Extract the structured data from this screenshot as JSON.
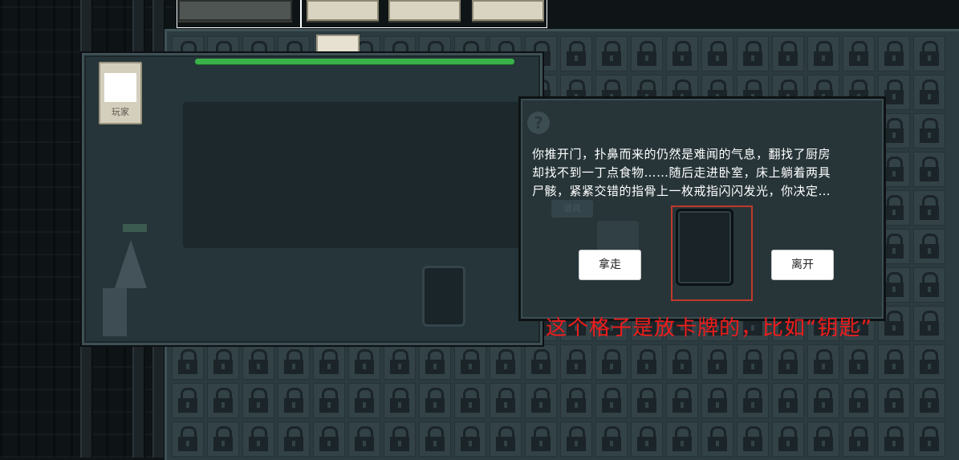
{
  "player_card": {
    "name": "玩家"
  },
  "health_bar": {
    "fraction": 1.0,
    "color": "#3bb24a"
  },
  "event_dialog": {
    "icon": "question-icon",
    "story_lines": [
      "你推开门，扑鼻而来的仍然是难闻的气息，翻找了厨房",
      "却找不到一丁点食物……随后走进卧室，床上躺着两具",
      "尸骸，紧紧交错的指骨上一枚戒指闪闪发光，你决定…"
    ],
    "take_button": "拿走",
    "leave_button": "离开",
    "faint_button": "道具"
  },
  "annotation": {
    "text": "这个格子是放卡牌的，比如“钥匙”",
    "color": "#ee1c1c"
  },
  "grid": {
    "icon": "lock-icon"
  }
}
